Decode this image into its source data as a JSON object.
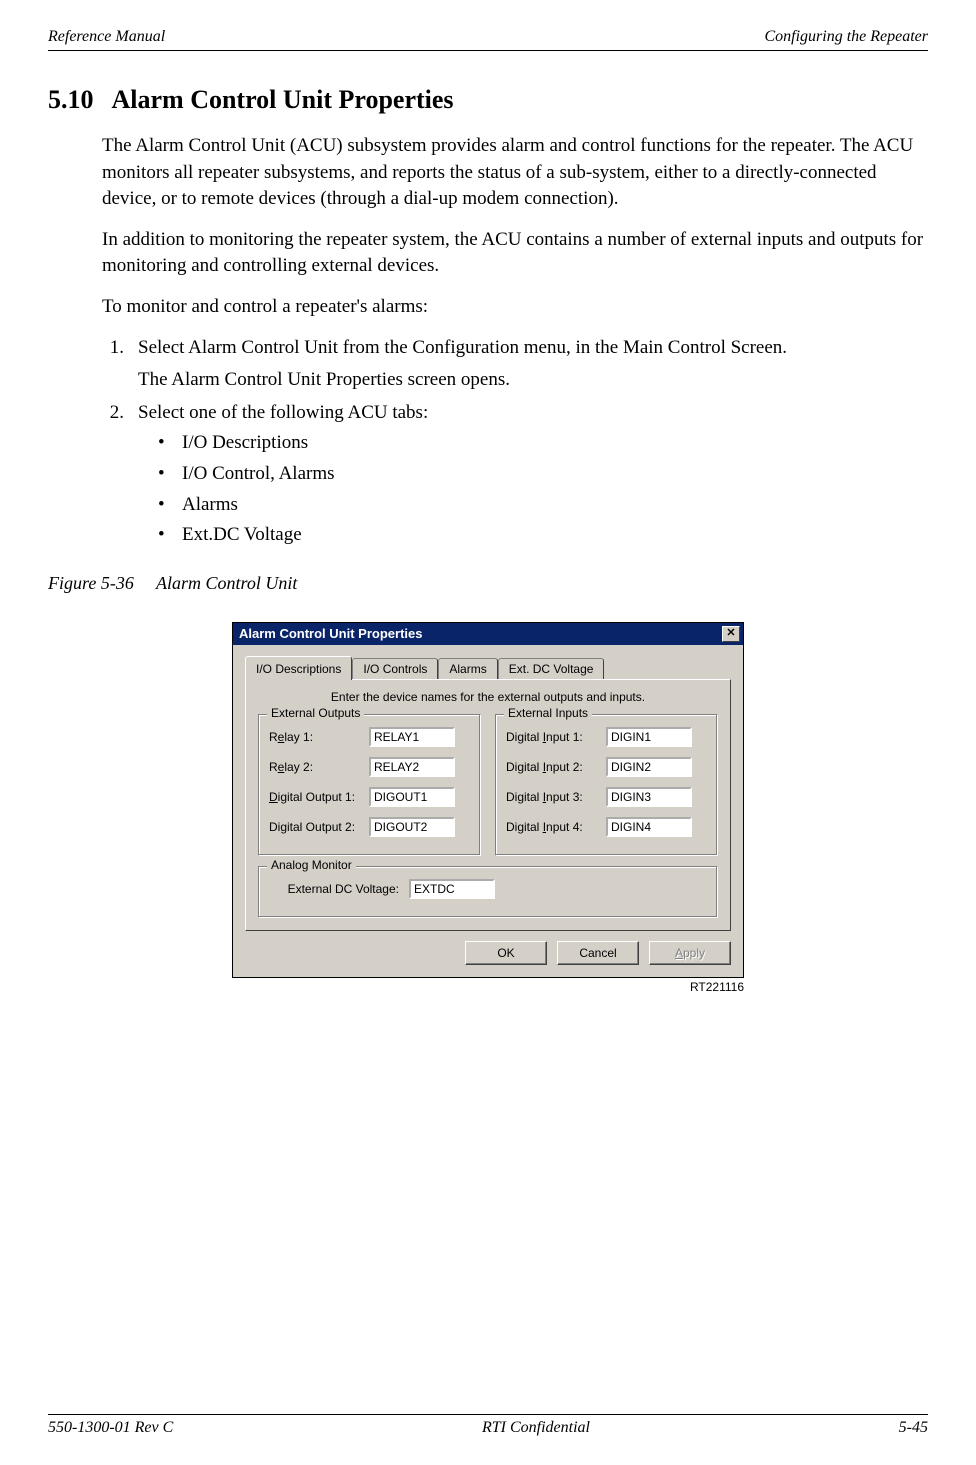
{
  "header": {
    "left": "Reference Manual",
    "right": "Configuring the Repeater"
  },
  "section": {
    "number": "5.10",
    "title": "Alarm Control Unit Properties"
  },
  "paragraphs": {
    "p1": "The Alarm Control Unit (ACU) subsystem provides alarm and control functions for the repeater. The ACU monitors all repeater subsystems, and reports the status of a sub-system, either to a directly-connected device, or to remote devices (through a dial-up modem connection).",
    "p2": "In addition to monitoring the repeater system, the ACU contains a number of external inputs and outputs for monitoring and controlling external devices.",
    "p3": "To monitor and control a repeater's alarms:"
  },
  "steps": {
    "s1_num": "1.",
    "s1_text": "Select Alarm Control Unit from the Configuration menu, in the Main Control Screen.",
    "s1_sub": "The Alarm Control Unit Properties screen opens.",
    "s2_num": "2.",
    "s2_text": "Select one of the following ACU tabs:",
    "bullets": {
      "b1": "I/O Descriptions",
      "b2": "I/O Control, Alarms",
      "b3": "Alarms",
      "b4": "Ext.DC Voltage"
    }
  },
  "figure": {
    "label": "Figure 5-36",
    "title": "Alarm Control Unit",
    "image_id": "RT221116"
  },
  "dialog": {
    "title": "Alarm Control Unit Properties",
    "close": "✕",
    "tabs": {
      "t1": "I/O Descriptions",
      "t2": "I/O Controls",
      "t3": "Alarms",
      "t4": "Ext. DC Voltage"
    },
    "instruction": "Enter the device names for the external outputs and inputs.",
    "outputs_legend": "External Outputs",
    "inputs_legend": "External Inputs",
    "analog_legend": "Analog Monitor",
    "outputs": {
      "r1_pre": "R",
      "r1_mn": "e",
      "r1_post": "lay 1:",
      "r1_val": "RELAY1",
      "r2_pre": "R",
      "r2_mn": "e",
      "r2_post": "lay 2:",
      "r2_val": "RELAY2",
      "d1_pre": "",
      "d1_mn": "D",
      "d1_post": "igital Output 1:",
      "d1_val": "DIGOUT1",
      "d2_label": "Digital Output 2:",
      "d2_val": "DIGOUT2"
    },
    "inputs": {
      "i1_pre": "Digital ",
      "i1_mn": "I",
      "i1_post": "nput 1:",
      "i1_val": "DIGIN1",
      "i2_pre": "Digital ",
      "i2_mn": "I",
      "i2_post": "nput 2:",
      "i2_val": "DIGIN2",
      "i3_pre": "Digital ",
      "i3_mn": "I",
      "i3_post": "nput 3:",
      "i3_val": "DIGIN3",
      "i4_pre": "Digital ",
      "i4_mn": "I",
      "i4_post": "nput 4:",
      "i4_val": "DIGIN4"
    },
    "analog": {
      "label": "External DC Voltage:",
      "value": "EXTDC"
    },
    "buttons": {
      "ok": "OK",
      "cancel": "Cancel",
      "apply_pre": "",
      "apply_mn": "A",
      "apply_post": "pply"
    }
  },
  "footer": {
    "left": "550-1300-01 Rev C",
    "center": "RTI Confidential",
    "right": "5-45"
  }
}
